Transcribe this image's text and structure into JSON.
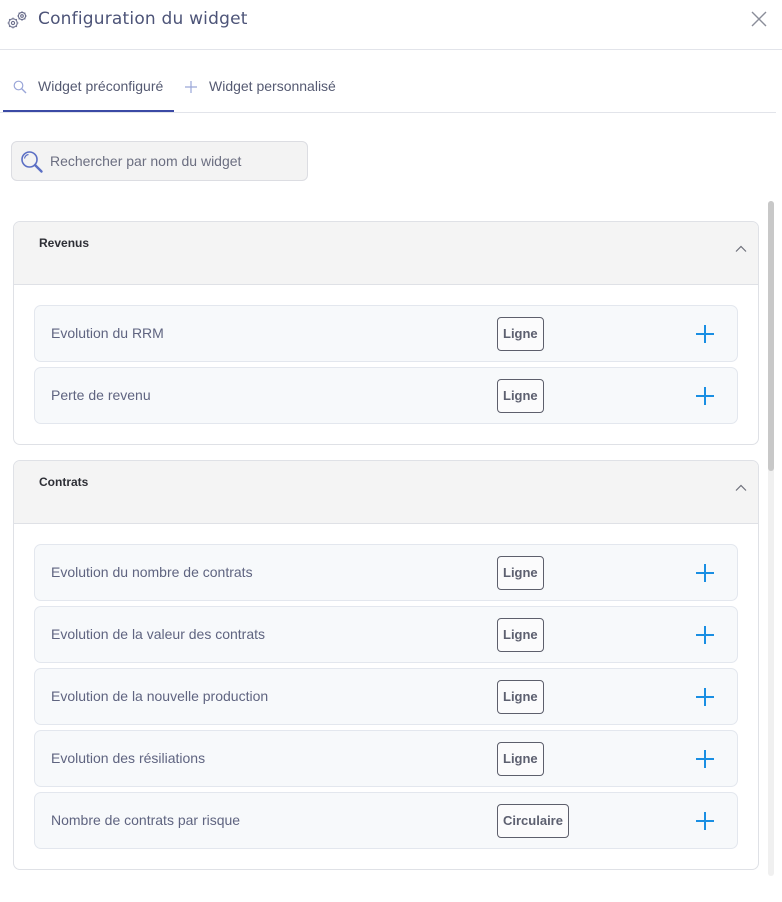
{
  "header": {
    "title": "Configuration du widget",
    "icon": "gears-icon",
    "close_icon": "close-icon"
  },
  "tabs": [
    {
      "label": "Widget préconfiguré",
      "icon": "search-icon",
      "active": true
    },
    {
      "label": "Widget personnalisé",
      "icon": "plus-icon",
      "active": false
    }
  ],
  "search": {
    "placeholder": "Rechercher par nom du widget",
    "value": ""
  },
  "sections": [
    {
      "title": "Revenus",
      "expanded": true,
      "items": [
        {
          "label": "Evolution du RRM",
          "type": "Ligne"
        },
        {
          "label": "Perte de revenu",
          "type": "Ligne"
        }
      ]
    },
    {
      "title": "Contrats",
      "expanded": true,
      "items": [
        {
          "label": "Evolution du nombre de contrats",
          "type": "Ligne"
        },
        {
          "label": "Evolution de la valeur des contrats",
          "type": "Ligne"
        },
        {
          "label": "Evolution de la nouvelle production",
          "type": "Ligne"
        },
        {
          "label": "Evolution des résiliations",
          "type": "Ligne"
        },
        {
          "label": "Nombre de contrats par risque",
          "type": "Circulaire"
        }
      ]
    }
  ],
  "colors": {
    "accent": "#1a8fe3",
    "tab_active": "#3b4aa5",
    "title": "#4d5478"
  }
}
